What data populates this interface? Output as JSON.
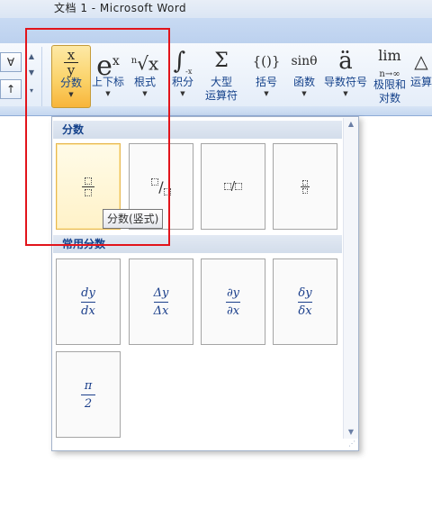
{
  "window": {
    "title": "文档 1 - Microsoft Word"
  },
  "ribbon": {
    "left_mini": [
      {
        "glyph": "∀"
      },
      {
        "glyph": "↑"
      }
    ],
    "buttons": [
      {
        "id": "fraction",
        "label": "分数",
        "glyph": "x/y",
        "active": true
      },
      {
        "id": "script",
        "label": "上下标",
        "glyph": "eˣ"
      },
      {
        "id": "radical",
        "label": "根式",
        "glyph": "ⁿ√x"
      },
      {
        "id": "integral",
        "label": "积分",
        "glyph": "∫"
      },
      {
        "id": "large-operator",
        "label": "大型",
        "label2": "运算符",
        "glyph": "Σ"
      },
      {
        "id": "bracket",
        "label": "括号",
        "glyph": "{()}"
      },
      {
        "id": "function",
        "label": "函数",
        "glyph": "sinθ"
      },
      {
        "id": "accent",
        "label": "导数符号",
        "glyph": "ä"
      },
      {
        "id": "limit-log",
        "label": "极限和",
        "label2": "对数",
        "glyph": "lim"
      },
      {
        "id": "operator",
        "label": "运算",
        "glyph": "△"
      }
    ]
  },
  "panel": {
    "section1": {
      "title": "分数"
    },
    "section2": {
      "title": "常用分数"
    },
    "common_fractions": [
      {
        "num": "dy",
        "den": "dx"
      },
      {
        "num": "Δy",
        "den": "Δx"
      },
      {
        "num": "∂y",
        "den": "∂x"
      },
      {
        "num": "δy",
        "den": "δx"
      },
      {
        "num": "π",
        "den": "2"
      }
    ]
  },
  "tooltip": {
    "text": "分数(竖式)"
  },
  "colors": {
    "highlight": "#e2141b",
    "accent": "#fbd36a",
    "ribbon_text": "#15428b"
  }
}
